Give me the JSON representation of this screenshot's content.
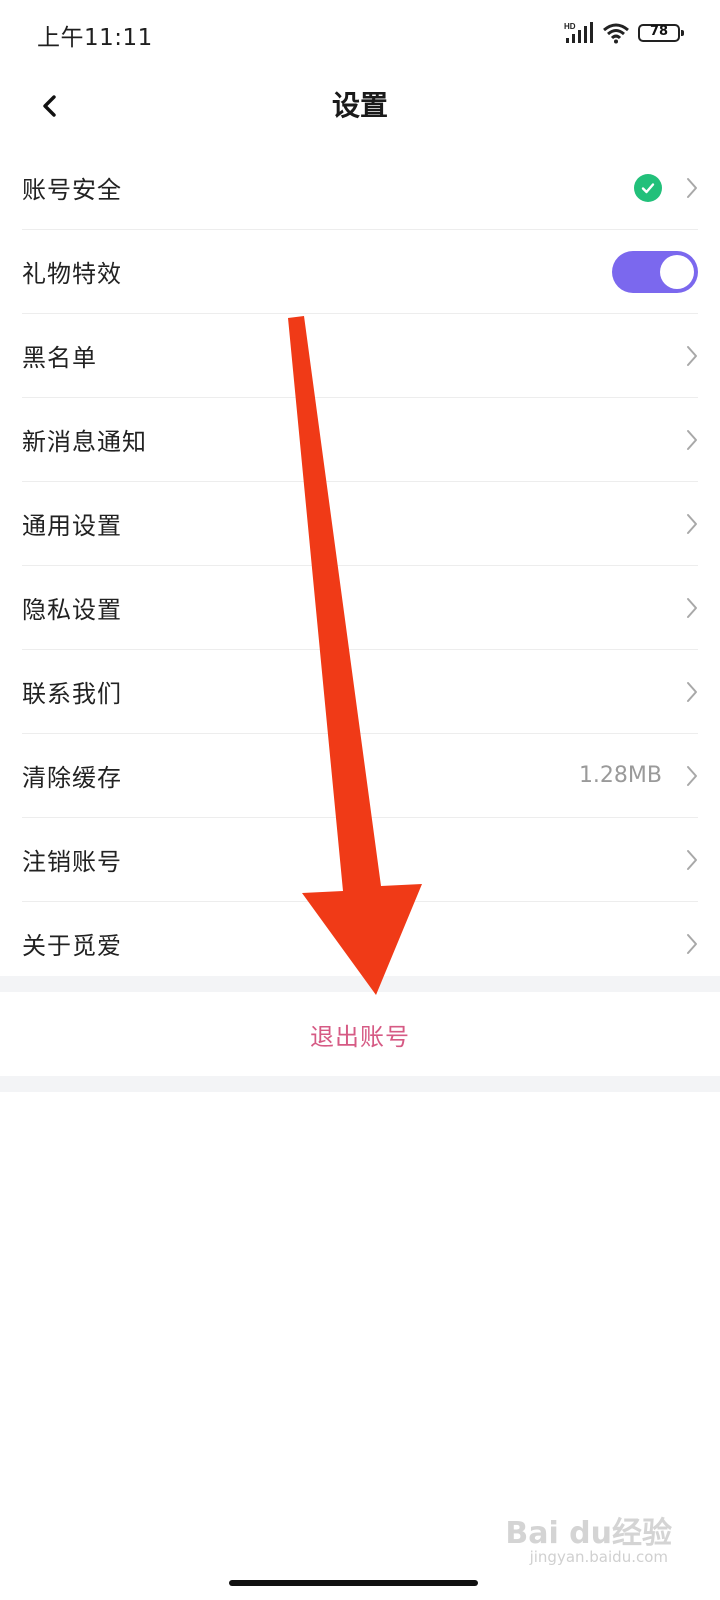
{
  "status_bar": {
    "time": "上午11:11",
    "battery": "78"
  },
  "header": {
    "title": "设置"
  },
  "colors": {
    "accent": "#7b68ee",
    "check_green": "#22c07a",
    "logout_pink": "#d65a84",
    "arrow_red": "#f03a17"
  },
  "settings": [
    {
      "label": "账号安全",
      "value": "",
      "indicator": "check-icon"
    },
    {
      "label": "礼物特效",
      "value": "",
      "control": "toggle",
      "toggle_on": true
    },
    {
      "label": "黑名单",
      "value": ""
    },
    {
      "label": "新消息通知",
      "value": ""
    },
    {
      "label": "通用设置",
      "value": ""
    },
    {
      "label": "隐私设置",
      "value": ""
    },
    {
      "label": "联系我们",
      "value": ""
    },
    {
      "label": "清除缓存",
      "value": "1.28MB"
    },
    {
      "label": "注销账号",
      "value": ""
    },
    {
      "label": "关于觅爱",
      "value": ""
    }
  ],
  "logout": {
    "label": "退出账号"
  },
  "watermark": {
    "brand": "Bai du经验",
    "url": "jingyan.baidu.com"
  }
}
